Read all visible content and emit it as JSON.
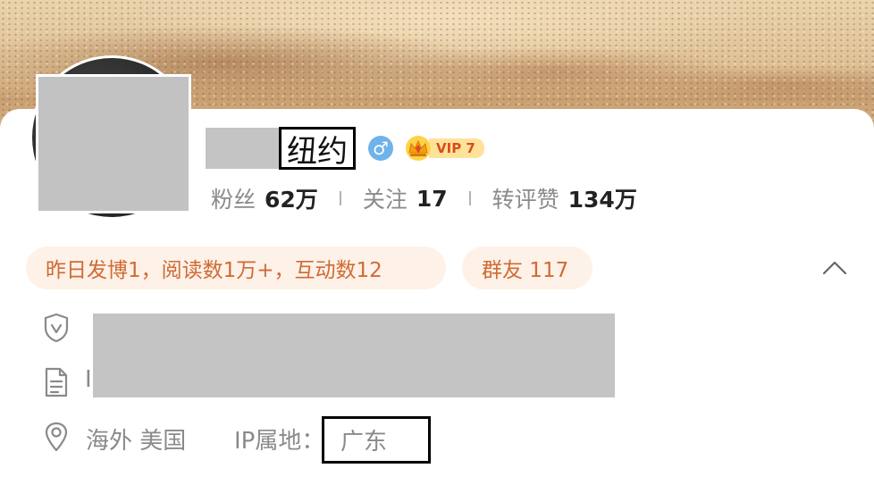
{
  "profile": {
    "name_visible": "纽约",
    "gender_symbol": "♂",
    "vip_label": "VIP 7"
  },
  "stats": [
    {
      "label": "粉丝",
      "value": "62万"
    },
    {
      "label": "关注",
      "value": "17"
    },
    {
      "label": "转评赞",
      "value": "134万"
    }
  ],
  "chips": {
    "activity": "昨日发博1，阅读数1万+，互动数12",
    "group_friends": "群友 117"
  },
  "info": {
    "description_prefix": "I",
    "location": "海外 美国",
    "ip_label": "IP属地：",
    "ip_value": "广东"
  },
  "icons": {
    "verify": "shield-check-icon",
    "description": "document-icon",
    "location": "map-pin-icon",
    "collapse": "chevron-up-icon",
    "gender": "male-icon",
    "vip": "crown-icon"
  },
  "colors": {
    "chip_bg": "#fdf1e8",
    "chip_text": "#d06b33",
    "male_badge": "#6fb3ea",
    "vip_bg": "#ffe29a",
    "vip_text": "#d64d1f"
  }
}
